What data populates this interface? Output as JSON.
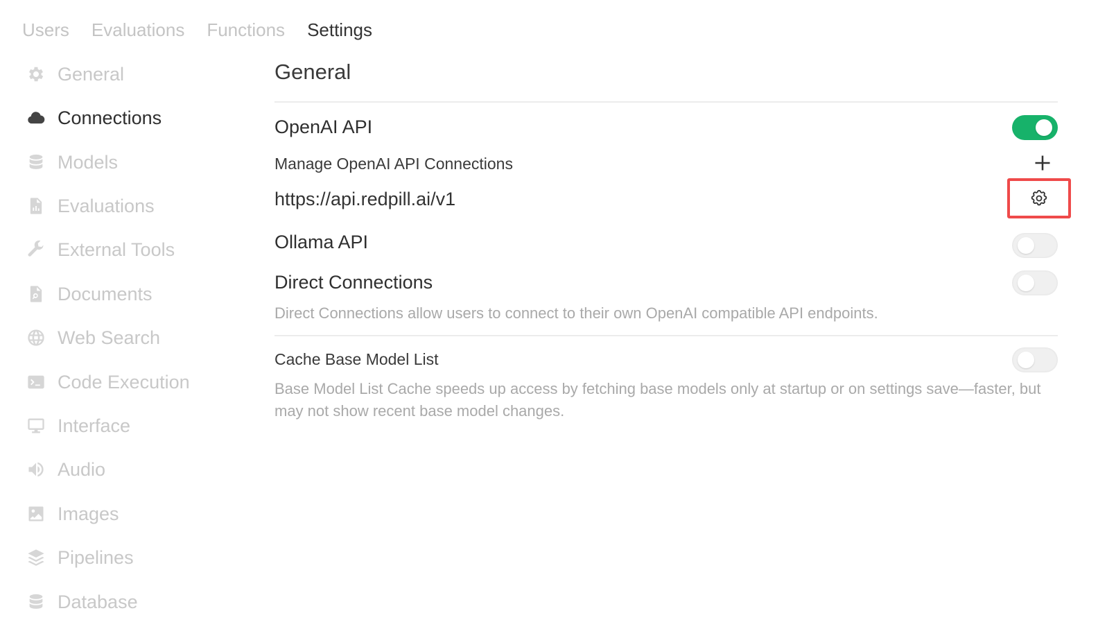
{
  "top_tabs": [
    {
      "label": "Users",
      "active": false
    },
    {
      "label": "Evaluations",
      "active": false
    },
    {
      "label": "Functions",
      "active": false
    },
    {
      "label": "Settings",
      "active": true
    }
  ],
  "sidebar": {
    "items": [
      {
        "label": "General",
        "icon": "gear-icon",
        "active": false
      },
      {
        "label": "Connections",
        "icon": "cloud-icon",
        "active": true
      },
      {
        "label": "Models",
        "icon": "database-icon",
        "active": false
      },
      {
        "label": "Evaluations",
        "icon": "document-chart-icon",
        "active": false
      },
      {
        "label": "External Tools",
        "icon": "wrench-icon",
        "active": false
      },
      {
        "label": "Documents",
        "icon": "document-search-icon",
        "active": false
      },
      {
        "label": "Web Search",
        "icon": "globe-icon",
        "active": false
      },
      {
        "label": "Code Execution",
        "icon": "terminal-icon",
        "active": false
      },
      {
        "label": "Interface",
        "icon": "monitor-icon",
        "active": false
      },
      {
        "label": "Audio",
        "icon": "speaker-icon",
        "active": false
      },
      {
        "label": "Images",
        "icon": "image-icon",
        "active": false
      },
      {
        "label": "Pipelines",
        "icon": "layers-icon",
        "active": false
      },
      {
        "label": "Database",
        "icon": "database-icon",
        "active": false
      }
    ]
  },
  "main": {
    "title": "General",
    "openai": {
      "title": "OpenAI API",
      "enabled": true,
      "manage_label": "Manage OpenAI API Connections",
      "add_icon": "plus-icon",
      "connections": [
        {
          "url": "https://api.redpill.ai/v1",
          "settings_icon": "gear-icon"
        }
      ]
    },
    "ollama": {
      "title": "Ollama API",
      "enabled": false
    },
    "direct": {
      "title": "Direct Connections",
      "enabled": false,
      "description": "Direct Connections allow users to connect to their own OpenAI compatible API endpoints."
    },
    "cache": {
      "title": "Cache Base Model List",
      "enabled": false,
      "description": "Base Model List Cache speeds up access by fetching base models only at startup or on settings save—faster, but may not show recent base model changes."
    }
  },
  "colors": {
    "toggle_on": "#17b26a",
    "highlight_border": "#ef4a4a",
    "inactive_text": "#c8c8c8"
  }
}
